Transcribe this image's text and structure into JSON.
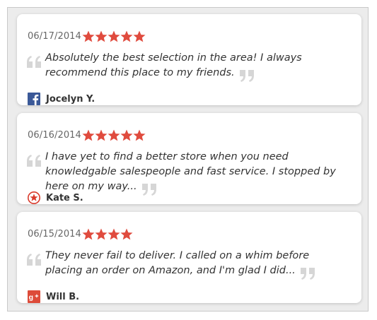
{
  "colors": {
    "star": "#e04b3e",
    "quote_mark": "#d6d6d6",
    "facebook": "#3b5998",
    "yelp_red": "#d93a2b",
    "google_plus": "#dd4b39",
    "text": "#333333",
    "date_text": "#666666"
  },
  "reviews": [
    {
      "date": "06/17/2014",
      "rating": 5,
      "text": "Absolutely the best selection in the area! I always recommend this place to my friends.",
      "author": "Jocelyn Y.",
      "source_icon": "facebook-icon"
    },
    {
      "date": "06/16/2014",
      "rating": 5,
      "text": "I have yet to find a better store when you need knowledgable salespeople and fast service. I stopped by here on my way...",
      "author": "Kate S.",
      "source_icon": "star-badge-icon"
    },
    {
      "date": "06/15/2014",
      "rating": 4,
      "text": "They never fail to deliver. I called on a whim before placing an order on Amazon, and I'm glad I did...",
      "author": "Will B.",
      "source_icon": "google-plus-icon"
    }
  ]
}
